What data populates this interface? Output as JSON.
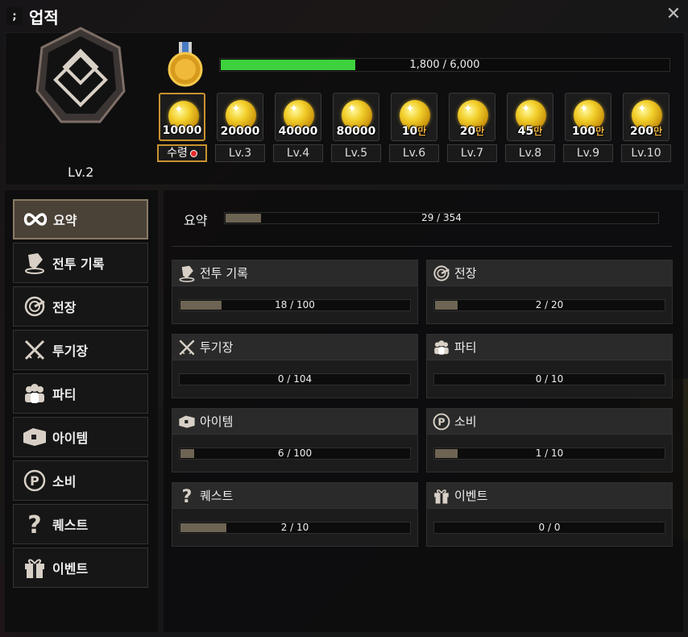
{
  "window": {
    "title": "업적",
    "close_glyph": "✕"
  },
  "profile": {
    "level_label": "Lv.2"
  },
  "xp": {
    "text": "1,800 / 6,000",
    "progress": 0.3
  },
  "rewards": [
    {
      "amount": "10000",
      "unit": "",
      "level": "수령",
      "claimable": true
    },
    {
      "amount": "20000",
      "unit": "",
      "level": "Lv.3"
    },
    {
      "amount": "40000",
      "unit": "",
      "level": "Lv.4"
    },
    {
      "amount": "80000",
      "unit": "",
      "level": "Lv.5"
    },
    {
      "amount": "10",
      "unit": "만",
      "level": "Lv.6"
    },
    {
      "amount": "20",
      "unit": "만",
      "level": "Lv.7"
    },
    {
      "amount": "45",
      "unit": "만",
      "level": "Lv.8"
    },
    {
      "amount": "100",
      "unit": "만",
      "level": "Lv.9"
    },
    {
      "amount": "200",
      "unit": "만",
      "level": "Lv.10"
    }
  ],
  "sidebar": {
    "items": [
      {
        "label": "요약",
        "icon": "infinity-icon"
      },
      {
        "label": "전투 기록",
        "icon": "battle-record-icon"
      },
      {
        "label": "전장",
        "icon": "battlefield-icon"
      },
      {
        "label": "투기장",
        "icon": "crossed-swords-icon"
      },
      {
        "label": "파티",
        "icon": "party-icon"
      },
      {
        "label": "아이템",
        "icon": "chest-icon"
      },
      {
        "label": "소비",
        "icon": "coin-icon"
      },
      {
        "label": "퀘스트",
        "icon": "question-icon"
      },
      {
        "label": "이벤트",
        "icon": "gift-icon"
      }
    ]
  },
  "summary": {
    "title": "요약",
    "text": "29 / 354",
    "progress": 0.082
  },
  "cards": [
    {
      "title": "전투 기록",
      "text": "18 / 100",
      "progress": 0.18,
      "icon": "battle-record-icon"
    },
    {
      "title": "전장",
      "text": "2 / 20",
      "progress": 0.1,
      "icon": "battlefield-icon"
    },
    {
      "title": "투기장",
      "text": "0 / 104",
      "progress": 0,
      "icon": "crossed-swords-icon"
    },
    {
      "title": "파티",
      "text": "0 / 10",
      "progress": 0,
      "icon": "party-icon"
    },
    {
      "title": "아이템",
      "text": "6 / 100",
      "progress": 0.06,
      "icon": "chest-icon"
    },
    {
      "title": "소비",
      "text": "1 / 10",
      "progress": 0.1,
      "icon": "coin-icon"
    },
    {
      "title": "퀘스트",
      "text": "2 / 10",
      "progress": 0.2,
      "icon": "question-icon"
    },
    {
      "title": "이벤트",
      "text": "0 / 0",
      "progress": 0,
      "icon": "gift-icon"
    }
  ]
}
